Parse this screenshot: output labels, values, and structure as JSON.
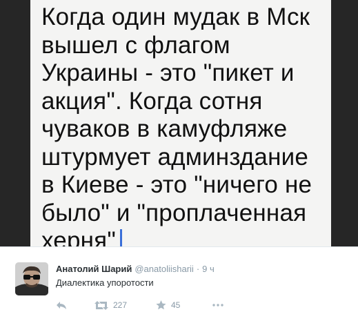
{
  "note": {
    "text": "Когда один мудак в Мск\nвышел с флагом\nУкраины - это \"пикет и\nакция\". Когда сотня\nчуваков в камуфляже\nштурмует админздание\nв Киеве - это \"ничего не\nбыло\" и \"проплаченная\nхерня\""
  },
  "tweet": {
    "fullname": "Анатолий Шарий",
    "username": "@anatoliisharii",
    "separator": "·",
    "time": "9 ч",
    "text": "Диалектика упоротости",
    "retweets": "227",
    "favorites": "45"
  },
  "icons": {
    "reply": "reply-icon",
    "retweet": "retweet-icon",
    "favorite": "star-icon",
    "more": "more-dots-icon"
  },
  "colors": {
    "icon_gray": "#aab8c2",
    "caret": "#3a6fd8"
  }
}
